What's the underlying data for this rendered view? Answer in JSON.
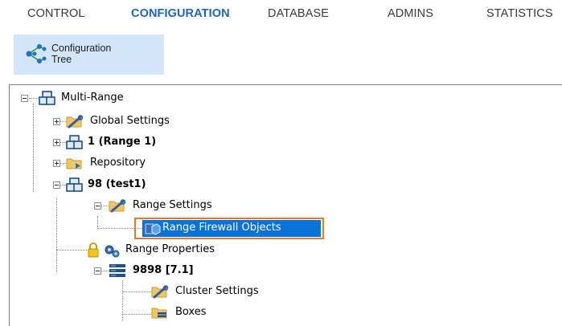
{
  "nav": {
    "tabs": [
      {
        "label": "CONTROL"
      },
      {
        "label": "CONFIGURATION"
      },
      {
        "label": "DATABASE"
      },
      {
        "label": "ADMINS"
      },
      {
        "label": "STATISTICS"
      }
    ],
    "active": "CONFIGURATION"
  },
  "ribbon": {
    "button_line1": "Configuration",
    "button_line2": "Tree",
    "button_icon": "tree-nodes-icon"
  },
  "tree": {
    "root": {
      "label": "Multi-Range",
      "icon": "range-cubes-icon"
    },
    "global_settings": {
      "label": "Global Settings",
      "icon": "folder-wrench-icon"
    },
    "range1": {
      "label": "1 (Range 1)",
      "icon": "range-cubes-icon"
    },
    "repository": {
      "label": "Repository",
      "icon": "folder-arrow-icon"
    },
    "range98": {
      "label": "98 (test1)",
      "icon": "range-cubes-icon"
    },
    "range_settings": {
      "label": "Range Settings",
      "icon": "folder-wrench-icon"
    },
    "range_firewall_objects": {
      "label": "Range Firewall Objects",
      "icon": "firewall-cube-icon",
      "selected": true
    },
    "range_properties": {
      "label": "Range Properties",
      "icon": "gears-icon",
      "locked": true
    },
    "cluster": {
      "label": "9898 [7.1]",
      "icon": "server-stack-icon"
    },
    "cluster_settings": {
      "label": "Cluster Settings",
      "icon": "folder-wrench-icon"
    },
    "boxes": {
      "label": "Boxes",
      "icon": "folder-boxes-icon"
    }
  },
  "colors": {
    "active_tab": "#1b63c6",
    "ribbon_button_bg": "#d2e5f9",
    "selection_bg": "#0a73d8",
    "highlight_border": "#ea7a27"
  }
}
